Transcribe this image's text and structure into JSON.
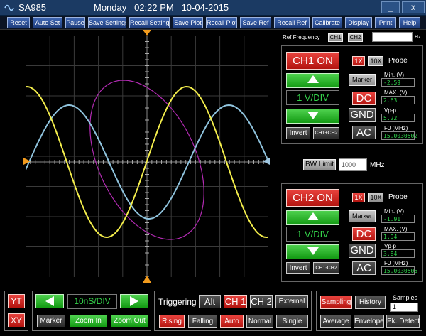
{
  "window": {
    "app_name": "SA985",
    "datetime": "Monday   02:22 PM   10-04-2015",
    "minimize_label": "_",
    "close_label": "x"
  },
  "toolbar": {
    "items": [
      "Reset",
      "Auto Set",
      "Pause",
      "Save Settings",
      "Recall Settings",
      "Save Plot",
      "Recall Plot",
      "Save Ref",
      "Recall Ref",
      "Calibrate",
      "Display",
      "Print",
      "Help"
    ]
  },
  "ref_frequency": {
    "label": "Ref Frequency",
    "ch1": "CH1",
    "ch2": "CH2",
    "value": "",
    "unit": "Hz"
  },
  "ch1": {
    "on_label": "CH1 ON",
    "probe_1x": "1X",
    "probe_10x": "10X",
    "probe_label": "Probe",
    "marker": "Marker",
    "scale": "1 V/DIV",
    "invert": "Invert",
    "ch1_ch2": "CH1+CH2",
    "dc": "DC",
    "gnd": "GND",
    "ac": "AC",
    "min_label": "Min. (V)",
    "min_value": "-2.59",
    "max_label": "MAX. (V)",
    "max_value": "2.63",
    "vpp_label": "Vp-p",
    "vpp_value": "5.22",
    "f0_label": "F0 (MHz)",
    "f0_value": "15.0030502"
  },
  "bw": {
    "label": "BW Limit",
    "value": "1000",
    "unit": "MHz"
  },
  "ch2": {
    "on_label": "CH2 ON",
    "probe_1x": "1X",
    "probe_10x": "10X",
    "probe_label": "Probe",
    "marker": "Marker",
    "scale": "1 V/DIV",
    "invert": "Invert",
    "ch1_ch2": "CH1-CH2",
    "dc": "DC",
    "gnd": "GND",
    "ac": "AC",
    "min_label": "Min. (V)",
    "min_value": "-1.91",
    "max_label": "MAX. (V)",
    "max_value": "1.94",
    "vpp_label": "Vp-p",
    "vpp_value": "3.84",
    "f0_label": "F0 (MHz)",
    "f0_value": "15.0030505"
  },
  "display_mode": {
    "yt": "YT",
    "xy": "XY"
  },
  "timebase": {
    "value": "10nS/DIV",
    "marker": "Marker",
    "zoom_in": "Zoom In",
    "zoom_out": "Zoom Out"
  },
  "triggering": {
    "label": "Triggering",
    "alt": "Alt",
    "ch1": "CH 1",
    "ch2": "CH 2",
    "external": "External",
    "rising": "Rising",
    "falling": "Falling",
    "auto": "Auto",
    "normal": "Normal",
    "single": "Single"
  },
  "acquisition": {
    "sampling": "Sampling",
    "history": "History",
    "samples_label": "Samples",
    "samples_value": "1",
    "average": "Average",
    "envelope": "Envelope",
    "pk_detect": "Pk. Detect"
  },
  "colors": {
    "ch1_trace": "#f4ee4c",
    "ch2_trace": "#8fc3dd",
    "xy_trace": "#b32bb3",
    "active_red": "#d9221b",
    "accent_green": "#2fd13f"
  }
}
